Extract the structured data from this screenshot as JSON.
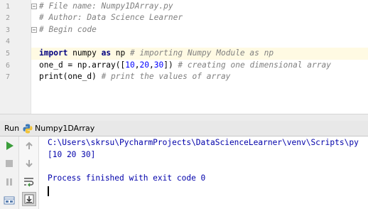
{
  "editor": {
    "line_numbers": [
      "1",
      "2",
      "3",
      "4",
      "5",
      "6",
      "7"
    ],
    "lines": {
      "l1": {
        "comment": "# File name: Numpy1DArray.py"
      },
      "l2": {
        "comment": "# Author: Data Science Learner"
      },
      "l3": {
        "comment": "# Begin code"
      },
      "l5": {
        "kw_import": "import",
        "module": " numpy ",
        "kw_as": "as",
        "alias": " np ",
        "comment": "# importing Numpy Module as np"
      },
      "l6": {
        "code_a": "one_d = np.array([",
        "n1": "10",
        "c1": ",",
        "n2": "20",
        "c2": ",",
        "n3": "30",
        "code_b": "]) ",
        "comment": "# creating one dimensional array"
      },
      "l7": {
        "code": "print(one_d) ",
        "comment": "# print the values of array"
      }
    }
  },
  "run_window": {
    "tab_label": "Run",
    "config_name": "Numpy1DArray",
    "config_icon": "python-icon",
    "toolbar_icons": [
      "rerun-icon",
      "stop-icon",
      "pause-icon",
      "restore-layout-icon",
      "scroll-up-icon",
      "scroll-down-icon",
      "soft-wrap-icon",
      "scroll-to-end-icon"
    ],
    "console": {
      "command": "C:\\Users\\skrsu\\PycharmProjects\\DataScienceLearner\\venv\\Scripts\\py",
      "output": "[10 20 30]",
      "exit_message": "Process finished with exit code 0"
    }
  },
  "colors": {
    "keyword": "#000080",
    "comment": "#808080",
    "number": "#0000ff",
    "console_text": "#0000aa",
    "caret_line": "#fffae3",
    "run_green": "#3b9e3b"
  }
}
